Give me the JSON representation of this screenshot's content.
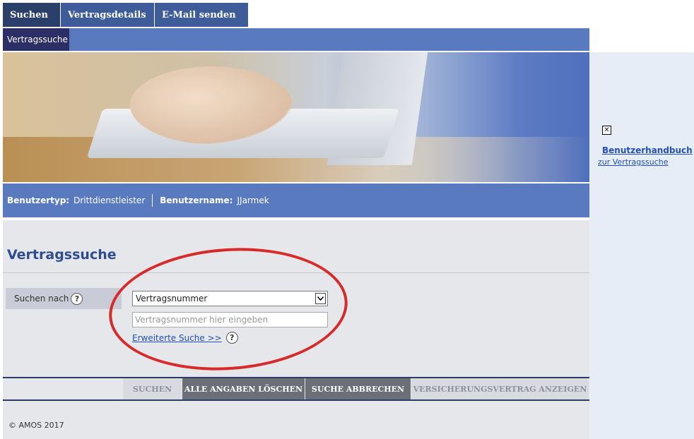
{
  "tabs": [
    {
      "label": "Suchen",
      "active": true
    },
    {
      "label": "Vertragsdetails",
      "active": false
    },
    {
      "label": "E-Mail senden",
      "active": false
    }
  ],
  "subnav": {
    "active_label": "Vertragssuche"
  },
  "userbar": {
    "type_label": "Benutzertyp:",
    "type_value": "Drittdienstleister",
    "name_label": "Benutzername:",
    "name_value": "JJarmek"
  },
  "main": {
    "title": "Vertragssuche",
    "search_label": "Suchen nach",
    "select_value": "Vertragsnummer",
    "input_placeholder": "Vertragsnummer hier eingeben",
    "advanced_link": "Erweiterte Suche >>",
    "help_glyph": "?"
  },
  "buttons": {
    "search": "SUCHEN",
    "clear": "ALLE ANGABEN LÖSCHEN",
    "cancel": "SUCHE ABBRECHEN",
    "show_contract": "VERSICHERUNGSVERTRAG ANZEIGEN"
  },
  "footer": {
    "copyright": "© AMOS 2017"
  },
  "sidebar": {
    "manual_link": "Benutzerhandbuch",
    "manual_sub": "zur Vertragssuche",
    "broken_icon": "broken-image-icon"
  },
  "colors": {
    "nav_dark": "#2b3f6b",
    "nav_blue": "#5a7ac0",
    "title_blue": "#2d4d8f",
    "annotation_red": "#d62b2b"
  }
}
